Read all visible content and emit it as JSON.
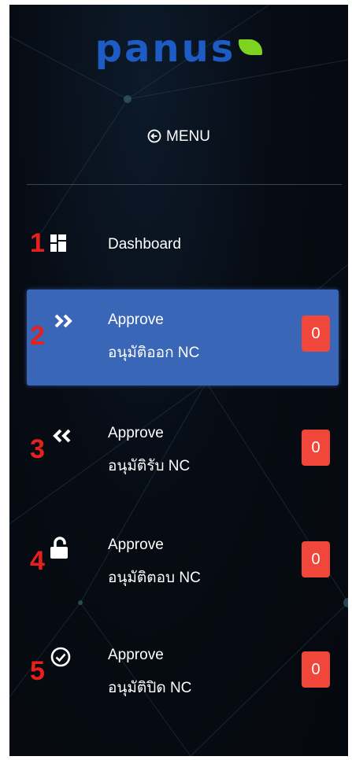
{
  "brand": {
    "logo_text": "panus",
    "leaf_color": "#7ed321",
    "brand_color": "#1c5cc4"
  },
  "menu": {
    "label": "MENU",
    "icon": "arrow-left-circle-icon"
  },
  "nav": [
    {
      "number": "1",
      "icon": "grid-icon",
      "line1": "Dashboard"
    },
    {
      "number": "2",
      "icon": "chevrons-right-icon",
      "line1": "Approve",
      "line2": "อนุมัติออก NC",
      "badge": "0"
    },
    {
      "number": "3",
      "icon": "chevrons-left-icon",
      "line1": "Approve",
      "line2": "อนุมัติรับ NC",
      "badge": "0"
    },
    {
      "number": "4",
      "icon": "unlock-icon",
      "line1": "Approve",
      "line2": "อนุมัติตอบ NC",
      "badge": "0"
    },
    {
      "number": "5",
      "icon": "check-circle-icon",
      "line1": "Approve",
      "line2": "อนุมัติปิด NC",
      "badge": "0"
    }
  ],
  "colors": {
    "active_bg": "#3a66b8",
    "badge_bg": "#f0473a",
    "annotation": "#e8201c"
  }
}
